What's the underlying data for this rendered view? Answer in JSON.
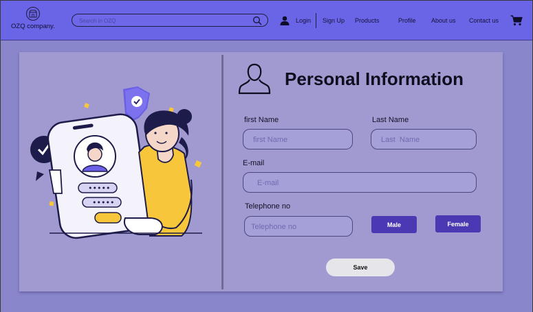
{
  "colors": {
    "background": "#8a86cc",
    "navbar": "#6a64e6",
    "card": "#a09ad0",
    "gender_button": "#4b39b3",
    "save_button": "#e6e6ea",
    "accent_yellow": "#f7c63a"
  },
  "brand": {
    "name": "OZQ company.",
    "badge_text": "OZQ"
  },
  "search": {
    "placeholder": "Search in OZQ",
    "icon": "search-icon"
  },
  "nav": {
    "login_icon": "user-icon",
    "login": "Login",
    "signup": "Sign Up",
    "products": "Products",
    "profile": "Profile",
    "about": "About us",
    "contact": "Contact us",
    "cart_icon": "cart-icon"
  },
  "form": {
    "title": "Personal Information",
    "title_icon": "person-outline-icon",
    "first_name": {
      "label": "first Name",
      "placeholder": "first Name"
    },
    "last_name": {
      "label": "Last  Name",
      "placeholder": "Last  Name"
    },
    "email": {
      "label": "E-mail",
      "placeholder": "E-mail"
    },
    "telephone": {
      "label": "Telephone no",
      "placeholder": "Telephone no"
    },
    "male": "Male",
    "female": "Female",
    "save": "Save"
  },
  "illustration": {
    "masked_password": "•••••",
    "masked_password_2": "•••••"
  }
}
